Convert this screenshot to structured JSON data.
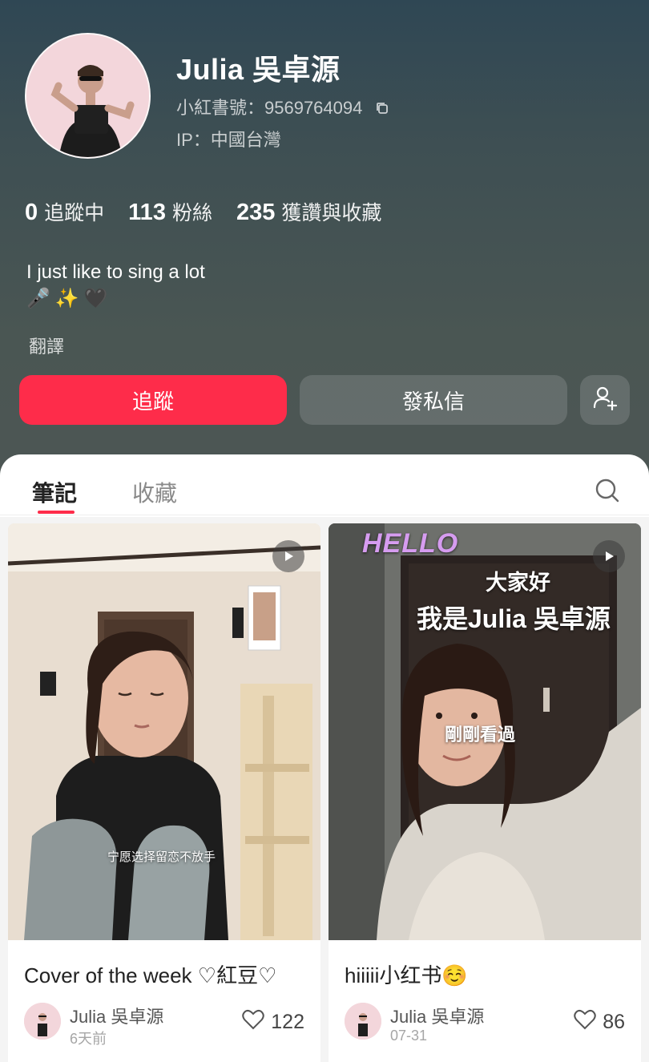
{
  "profile": {
    "name": "Julia 吳卓源",
    "id_text": "小紅書號：9569764094",
    "ip_text": "IP：中國台灣",
    "stats": [
      {
        "num": "0",
        "label": "追蹤中"
      },
      {
        "num": "113",
        "label": "粉絲"
      },
      {
        "num": "235",
        "label": "獲讚與收藏"
      }
    ],
    "bio": "I just like to sing a lot",
    "bio_emojis": [
      "🎤",
      "✨",
      "🖤"
    ],
    "translate": "翻譯"
  },
  "actions": {
    "follow": "追蹤",
    "message": "發私信"
  },
  "tabs": {
    "notes": "筆記",
    "collections": "收藏"
  },
  "posts": [
    {
      "title": "Cover of the week ♡紅豆♡",
      "author": "Julia 吳卓源",
      "date": "6天前",
      "likes": "122",
      "subtitle": "宁愿选择留恋不放手"
    },
    {
      "title": "hiiiii小红书☺️",
      "author": "Julia 吳卓源",
      "date": "07-31",
      "likes": "86",
      "overlay_hello": "HELLO",
      "overlay_line1": "大家好",
      "overlay_line2": "我是Julia 吳卓源",
      "overlay_seen": "剛剛看過"
    }
  ],
  "colors": {
    "accent": "#fe2c4a",
    "header": "#4a5653"
  },
  "icons": [
    "copy-icon",
    "add-friend-icon",
    "search-icon",
    "play-icon",
    "heart-icon"
  ]
}
